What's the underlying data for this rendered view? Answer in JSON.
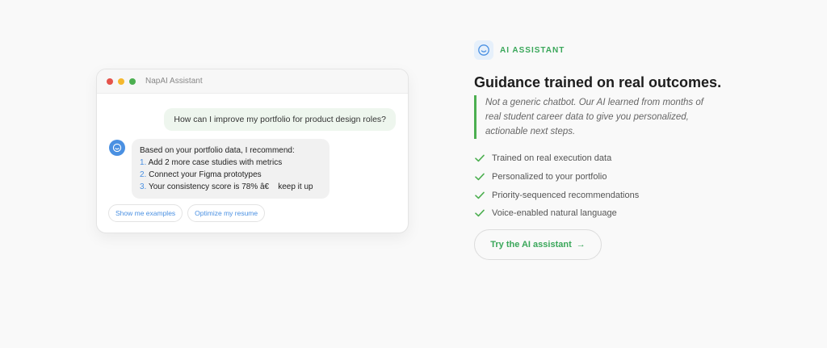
{
  "chat": {
    "window_title": "NapAI Assistant",
    "user_message": "How can I improve my portfolio for product design roles?",
    "bot_intro": "Based on your portfolio data, I recommend:",
    "bot_items": [
      {
        "num": "1.",
        "text": "Add 2 more case studies with metrics"
      },
      {
        "num": "2.",
        "text": "Connect your Figma prototypes"
      },
      {
        "num": "3.",
        "text": "Your consistency score is 78% â€    keep it up"
      }
    ],
    "chips": [
      "Show me examples",
      "Optimize my resume"
    ]
  },
  "badge": {
    "label": "AI ASSISTANT",
    "icon": "smile-icon"
  },
  "headline": "Guidance trained on real outcomes.",
  "description": "Not a generic chatbot. Our AI learned from months of real student career data to give you personalized, actionable next steps.",
  "features": [
    "Trained on real execution data",
    "Personalized to your portfolio",
    "Priority-sequenced recommendations",
    "Voice-enabled natural language"
  ],
  "cta": {
    "label": "Try the AI assistant",
    "arrow": "→"
  },
  "colors": {
    "accent_green": "#3aa75a",
    "accent_blue": "#4a90e2",
    "dot_red": "#e5534b",
    "dot_yellow": "#f5b82e",
    "dot_green": "#4caf50"
  }
}
